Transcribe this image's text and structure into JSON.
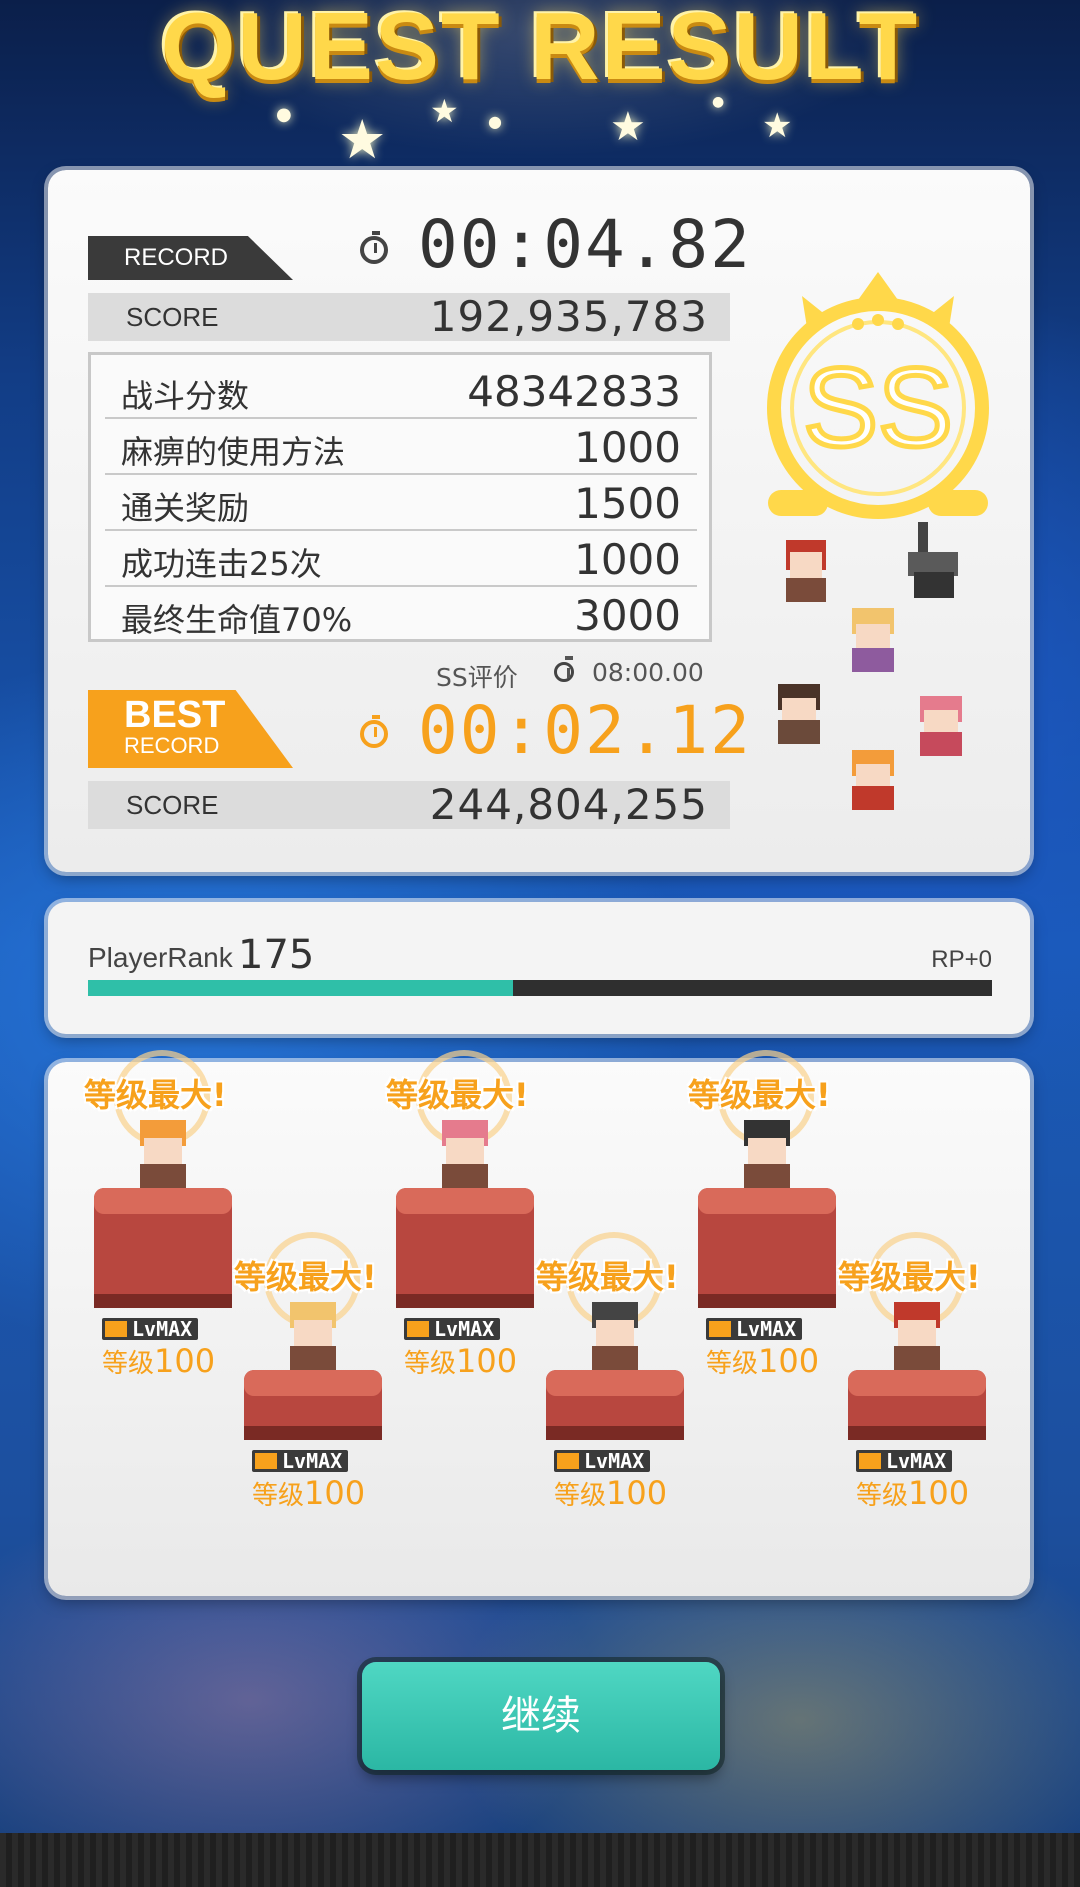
{
  "title": "QUEST RESULT",
  "record": {
    "tag": "RECORD",
    "time": "00:04.82",
    "score_label": "SCORE",
    "score": "192,935,783"
  },
  "bonuses": [
    {
      "label": "战斗分数",
      "value": "48342833"
    },
    {
      "label": "麻痹的使用方法",
      "value": "1000"
    },
    {
      "label": "通关奖励",
      "value": "1500"
    },
    {
      "label": "成功连击25次",
      "value": "1000"
    },
    {
      "label": "最终生命值70%",
      "value": "3000"
    }
  ],
  "ss_eval": {
    "label": "SS评价",
    "time": "08:00.00"
  },
  "best": {
    "tag_line1": "BEST",
    "tag_line2": "RECORD",
    "time": "00:02.12",
    "score_label": "SCORE",
    "score": "244,804,255"
  },
  "rank_badge": "SS",
  "player": {
    "rank_label": "PlayerRank",
    "rank": "175",
    "rp": "RP+0",
    "progress": 0.47
  },
  "party": [
    {
      "max_label": "等级最大!",
      "lv_badge": "LvMAX",
      "level_label": "等级",
      "level": "100"
    },
    {
      "max_label": "等级最大!",
      "lv_badge": "LvMAX",
      "level_label": "等级",
      "level": "100"
    },
    {
      "max_label": "等级最大!",
      "lv_badge": "LvMAX",
      "level_label": "等级",
      "level": "100"
    },
    {
      "max_label": "等级最大!",
      "lv_badge": "LvMAX",
      "level_label": "等级",
      "level": "100"
    },
    {
      "max_label": "等级最大!",
      "lv_badge": "LvMAX",
      "level_label": "等级",
      "level": "100"
    },
    {
      "max_label": "等级最大!",
      "lv_badge": "LvMAX",
      "level_label": "等级",
      "level": "100"
    }
  ],
  "continue_label": "继续",
  "colors": {
    "accent": "#f7a11c",
    "teal": "#2fbfa8",
    "gold": "#ffd84a"
  }
}
